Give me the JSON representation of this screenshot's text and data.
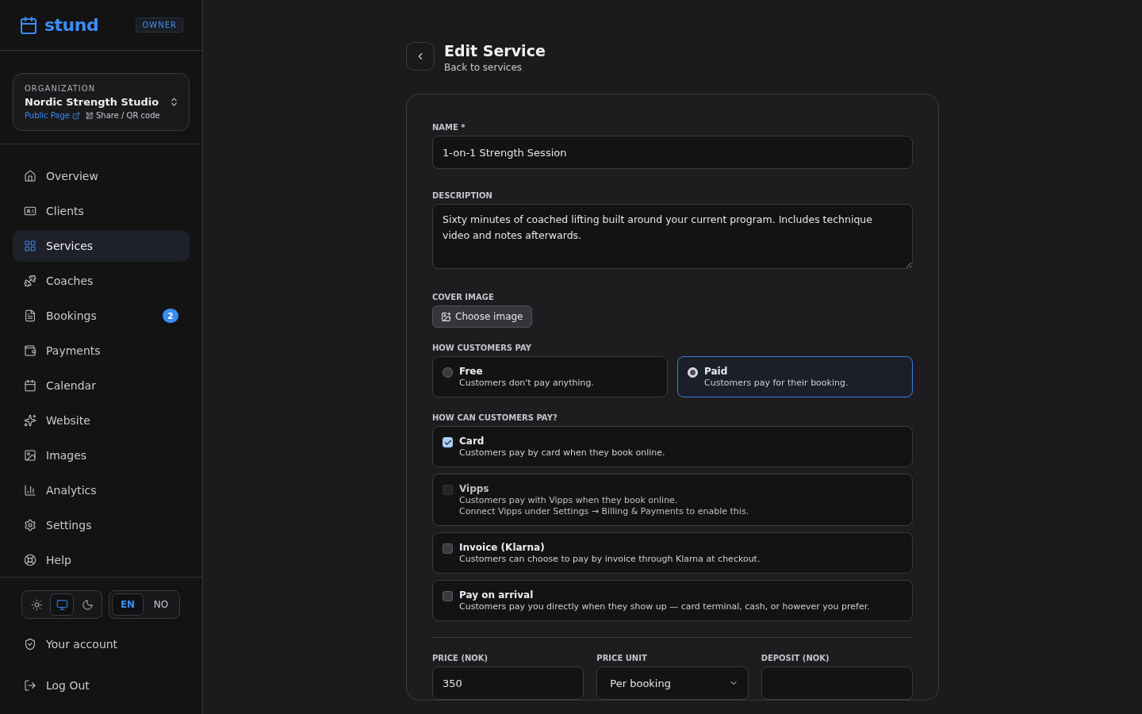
{
  "brand": {
    "name": "stund",
    "role": "OWNER"
  },
  "organization": {
    "label": "ORGANIZATION",
    "name": "Nordic Strength Studio",
    "public_link": "Public Page",
    "share": "Share / QR code"
  },
  "nav": [
    {
      "label": "Overview",
      "selected": false
    },
    {
      "label": "Clients",
      "selected": false
    },
    {
      "label": "Services",
      "selected": true
    },
    {
      "label": "Coaches",
      "selected": false
    },
    {
      "label": "Bookings",
      "selected": false,
      "badge": "2"
    },
    {
      "label": "Payments",
      "selected": false
    },
    {
      "label": "Calendar",
      "selected": false
    },
    {
      "label": "Website",
      "selected": false
    },
    {
      "label": "Images",
      "selected": false
    },
    {
      "label": "Analytics",
      "selected": false
    },
    {
      "label": "Settings",
      "selected": false
    },
    {
      "label": "Help",
      "selected": false
    }
  ],
  "theme_modes": [
    {
      "selected": false
    },
    {
      "selected": true
    },
    {
      "selected": false
    }
  ],
  "languages": [
    {
      "label": "EN",
      "selected": true
    },
    {
      "label": "NO",
      "selected": false
    }
  ],
  "account_links": [
    {
      "label": "Your account"
    },
    {
      "label": "Log Out"
    }
  ],
  "header": {
    "title": "Edit Service",
    "subtitle": "Back to services"
  },
  "form": {
    "name": {
      "label": "NAME *",
      "value": "1-on-1 Strength Session"
    },
    "description": {
      "label": "DESCRIPTION",
      "value": "Sixty minutes of coached lifting built around your current program. Includes technique video and notes afterwards."
    },
    "cover_image": {
      "label": "COVER IMAGE",
      "button": "Choose image"
    },
    "pay_mode": {
      "label": "HOW CUSTOMERS PAY",
      "options": [
        {
          "title": "Free",
          "description": "Customers don't pay anything.",
          "selected": false
        },
        {
          "title": "Paid",
          "description": "Customers pay for their booking.",
          "selected": true
        }
      ]
    },
    "pay_methods": {
      "label": "HOW CAN CUSTOMERS PAY?",
      "options": [
        {
          "title": "Card",
          "lines": [
            "Customers pay by card when they book online."
          ],
          "checked": true,
          "disabled": false
        },
        {
          "title": "Vipps",
          "lines": [
            "Customers pay with Vipps when they book online.",
            "Connect Vipps under Settings → Billing & Payments to enable this."
          ],
          "checked": false,
          "disabled": true
        },
        {
          "title": "Invoice (Klarna)",
          "lines": [
            "Customers can choose to pay by invoice through Klarna at checkout."
          ],
          "checked": false,
          "disabled": false
        },
        {
          "title": "Pay on arrival",
          "lines": [
            "Customers pay you directly when they show up — card terminal, cash, or however you prefer."
          ],
          "checked": false,
          "disabled": false
        }
      ]
    },
    "price_fields": [
      {
        "kind": "input",
        "label": "PRICE (NOK)",
        "value": "350"
      },
      {
        "kind": "select",
        "label": "PRICE UNIT",
        "value": "Per booking"
      },
      {
        "kind": "input",
        "label": "DEPOSIT (NOK)"
      }
    ]
  }
}
